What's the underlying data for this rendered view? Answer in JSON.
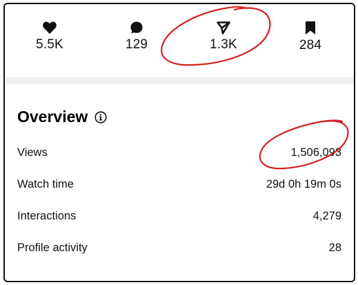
{
  "stats": [
    {
      "icon": "heart-icon",
      "count": "5.5K"
    },
    {
      "icon": "comment-icon",
      "count": "129"
    },
    {
      "icon": "share-icon",
      "count": "1.3K"
    },
    {
      "icon": "bookmark-icon",
      "count": "284"
    }
  ],
  "overview": {
    "title": "Overview",
    "info_icon": "info-icon",
    "rows": [
      {
        "label": "Views",
        "value": "1,506,093"
      },
      {
        "label": "Watch time",
        "value": "29d 0h 19m 0s"
      },
      {
        "label": "Interactions",
        "value": "4,279"
      },
      {
        "label": "Profile activity",
        "value": "28"
      }
    ]
  },
  "colors": {
    "annotation": "#d42020",
    "text": "#111111",
    "divider": "#f1f1f1"
  }
}
